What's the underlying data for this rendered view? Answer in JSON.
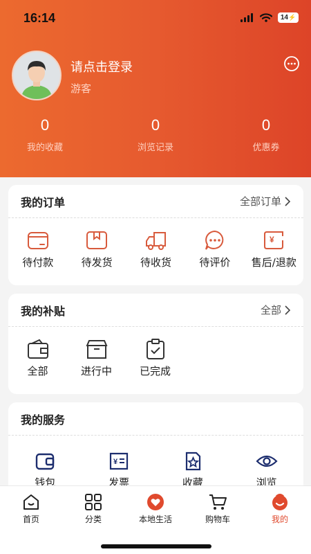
{
  "status_bar": {
    "time": "16:14",
    "battery": "14"
  },
  "profile": {
    "login_text": "请点击登录",
    "role": "游客"
  },
  "stats": [
    {
      "value": "0",
      "label": "我的收藏"
    },
    {
      "value": "0",
      "label": "浏览记录"
    },
    {
      "value": "0",
      "label": "优惠券"
    }
  ],
  "orders": {
    "title": "我的订单",
    "link": "全部订单",
    "items": [
      {
        "label": "待付款",
        "icon": "wallet-icon"
      },
      {
        "label": "待发货",
        "icon": "package-icon"
      },
      {
        "label": "待收货",
        "icon": "truck-icon"
      },
      {
        "label": "待评价",
        "icon": "chat-icon"
      },
      {
        "label": "售后/退款",
        "icon": "refund-icon"
      }
    ]
  },
  "subsidy": {
    "title": "我的补贴",
    "link": "全部",
    "items": [
      {
        "label": "全部",
        "icon": "wallet-icon"
      },
      {
        "label": "进行中",
        "icon": "box-icon"
      },
      {
        "label": "已完成",
        "icon": "clipboard-check-icon"
      }
    ]
  },
  "services": {
    "title": "我的服务",
    "items": [
      {
        "label": "钱包",
        "icon": "wallet-icon"
      },
      {
        "label": "发票",
        "icon": "invoice-icon"
      },
      {
        "label": "收藏",
        "icon": "bookmark-star-icon"
      },
      {
        "label": "浏览",
        "icon": "eye-icon"
      }
    ]
  },
  "tabbar": [
    {
      "label": "首页",
      "icon": "home-icon"
    },
    {
      "label": "分类",
      "icon": "category-icon"
    },
    {
      "label": "本地生活",
      "icon": "heart-icon"
    },
    {
      "label": "购物车",
      "icon": "cart-icon"
    },
    {
      "label": "我的",
      "icon": "profile-icon"
    }
  ],
  "colors": {
    "brand": "#e55a2d",
    "service_icon": "#1c2d6e",
    "order_icon": "#d85a3c"
  }
}
